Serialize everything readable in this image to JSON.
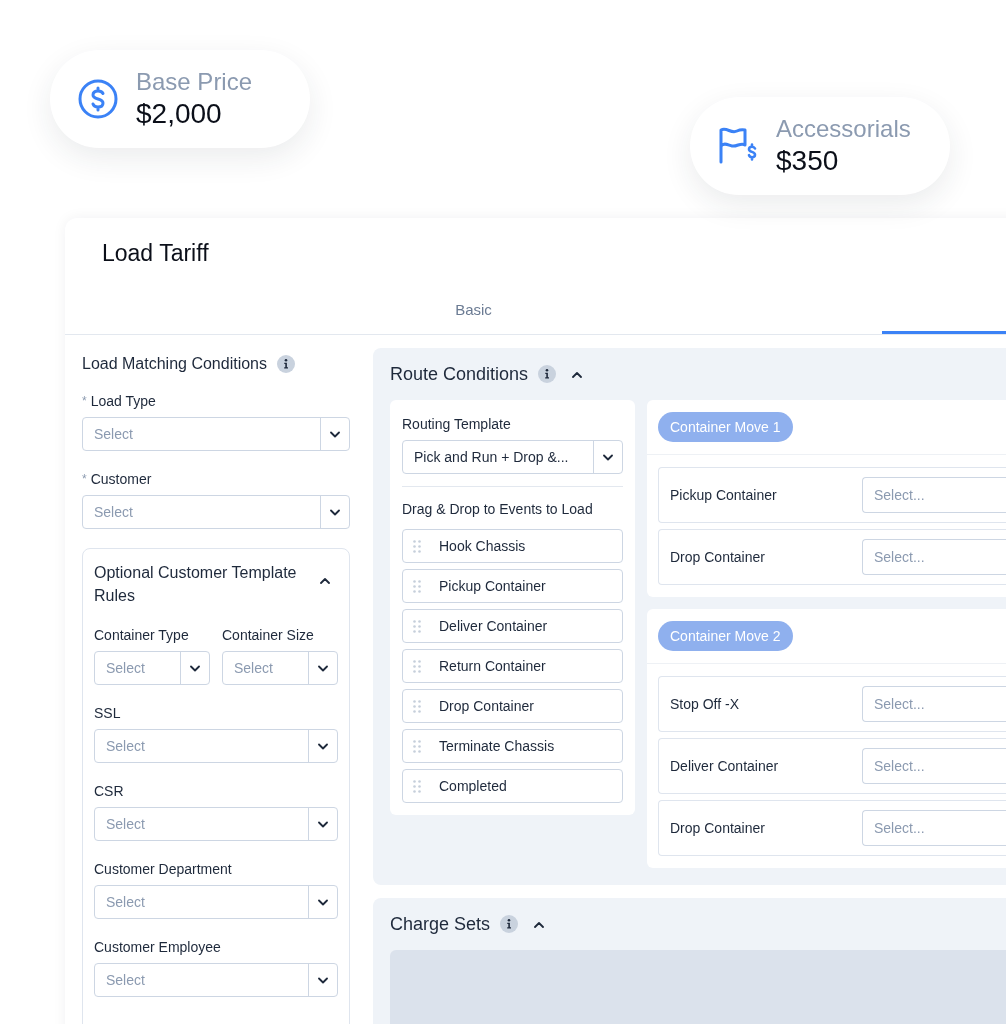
{
  "price_cards": [
    {
      "kind": "dollar",
      "label": "Base Price",
      "value": "$2,000"
    },
    {
      "kind": "flag",
      "label": "Accessorials",
      "value": "$350"
    }
  ],
  "panel": {
    "title": "Load Tariff",
    "tabs": [
      {
        "label": "Basic",
        "selected": false
      },
      {
        "selected": true
      }
    ]
  },
  "load_matching": {
    "title": "Load Matching Conditions",
    "fields": [
      {
        "mark": "*",
        "label": "Load Type",
        "placeholder": "Select"
      },
      {
        "mark": "*",
        "label": "Customer",
        "placeholder": "Select"
      }
    ],
    "optional_rules": {
      "title": "Optional Customer Template Rules",
      "expanded": true,
      "fields": [
        {
          "kind": "half",
          "label": "Container Type",
          "placeholder": "Select"
        },
        {
          "kind": "half",
          "label": "Container Size",
          "placeholder": "Select"
        },
        {
          "kind": "full",
          "label": "SSL",
          "placeholder": "Select"
        },
        {
          "kind": "full",
          "label": "CSR",
          "placeholder": "Select"
        },
        {
          "kind": "full",
          "label": "Customer Department",
          "placeholder": "Select"
        },
        {
          "kind": "full",
          "label": "Customer Employee",
          "placeholder": "Select"
        }
      ]
    }
  },
  "route_conditions": {
    "title": "Route Conditions",
    "expanded": true,
    "routing_template": {
      "label": "Routing Template",
      "value": "Pick and Run + Drop &..."
    },
    "events_title": "Drag & Drop to Events to Load",
    "events": [
      "Hook Chassis",
      "Pickup Container",
      "Deliver Container",
      "Return Container",
      "Drop Container",
      "Terminate Chassis",
      "Completed"
    ],
    "moves": [
      {
        "badge": "Container Move 1",
        "rows": [
          {
            "label": "Pickup Container",
            "placeholder": "Select..."
          },
          {
            "label": "Drop Container",
            "placeholder": "Select..."
          }
        ]
      },
      {
        "badge": "Container Move 2",
        "rows": [
          {
            "label": "Stop Off -X",
            "placeholder": "Select..."
          },
          {
            "label": "Deliver Container",
            "placeholder": "Select..."
          },
          {
            "label": "Drop Container",
            "placeholder": "Select..."
          }
        ]
      }
    ]
  },
  "charge_sets": {
    "title": "Charge Sets",
    "expanded": true
  }
}
